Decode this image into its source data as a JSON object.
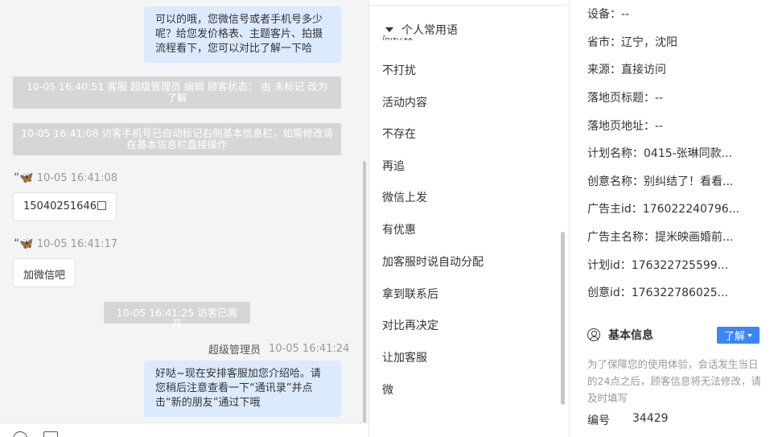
{
  "chat": {
    "messages": {
      "agent_reply_1": "可以的哦，您微信号或者手机号多少呢？给您发价格表、主题客片、拍摄流程看下，您可以对比了解一下哈",
      "sys_status_change": "10-05 16:40:51 客服 超级管理员 编辑 顾客状态： 由 未标记 改为 了解",
      "sys_auto_mark": "10-05 16:41:08 访客手机号已自动标记右侧基本信息栏，如需修改请在基本信息栏直接操作",
      "visitor_1_quote": "“",
      "visitor_1_time": "10-05 16:41:08",
      "visitor_1_text": "15040251646",
      "visitor_2_quote": "“",
      "visitor_2_time": "10-05 16:41:17",
      "visitor_2_text": "加微信吧",
      "sys_left": "10-05 16:41:25 访客已离开",
      "agent_name": "超级管理员",
      "agent_time": "10-05 16:41:24",
      "agent_reply_2": "好哒~现在安排客服加您介绍哈。请您稍后注意查看一下“通讯录”并点击“新的朋友”通过下哦"
    }
  },
  "phrases": {
    "header": "个人常用语",
    "partial_item": "问价格",
    "items": [
      "不打扰",
      "活动内容",
      "不存在",
      "再追",
      "微信上发",
      "有优惠",
      "加客服时说自动分配",
      "拿到联系后",
      "对比再决定",
      "让加客服",
      "微"
    ]
  },
  "info": {
    "rows": [
      "设备：--",
      "省市：辽宁，沈阳",
      "来源：直接访问",
      "落地页标题：--",
      "落地页地址：--",
      "计划名称：0415-张琳同款...",
      "创意名称：别纠结了！看看...",
      "广告主id：176022240796...",
      "广告主名称：提米映画婚前...",
      "计划id：176322725599...",
      "创意id：176322786025..."
    ],
    "section_title": "基本信息",
    "learn_button": "了解",
    "note": "为了保障您的使用体验，会话发生当日的24点之后，顾客信息将无法修改，请及时填写",
    "id_label": "编号",
    "id_value": "34429"
  }
}
